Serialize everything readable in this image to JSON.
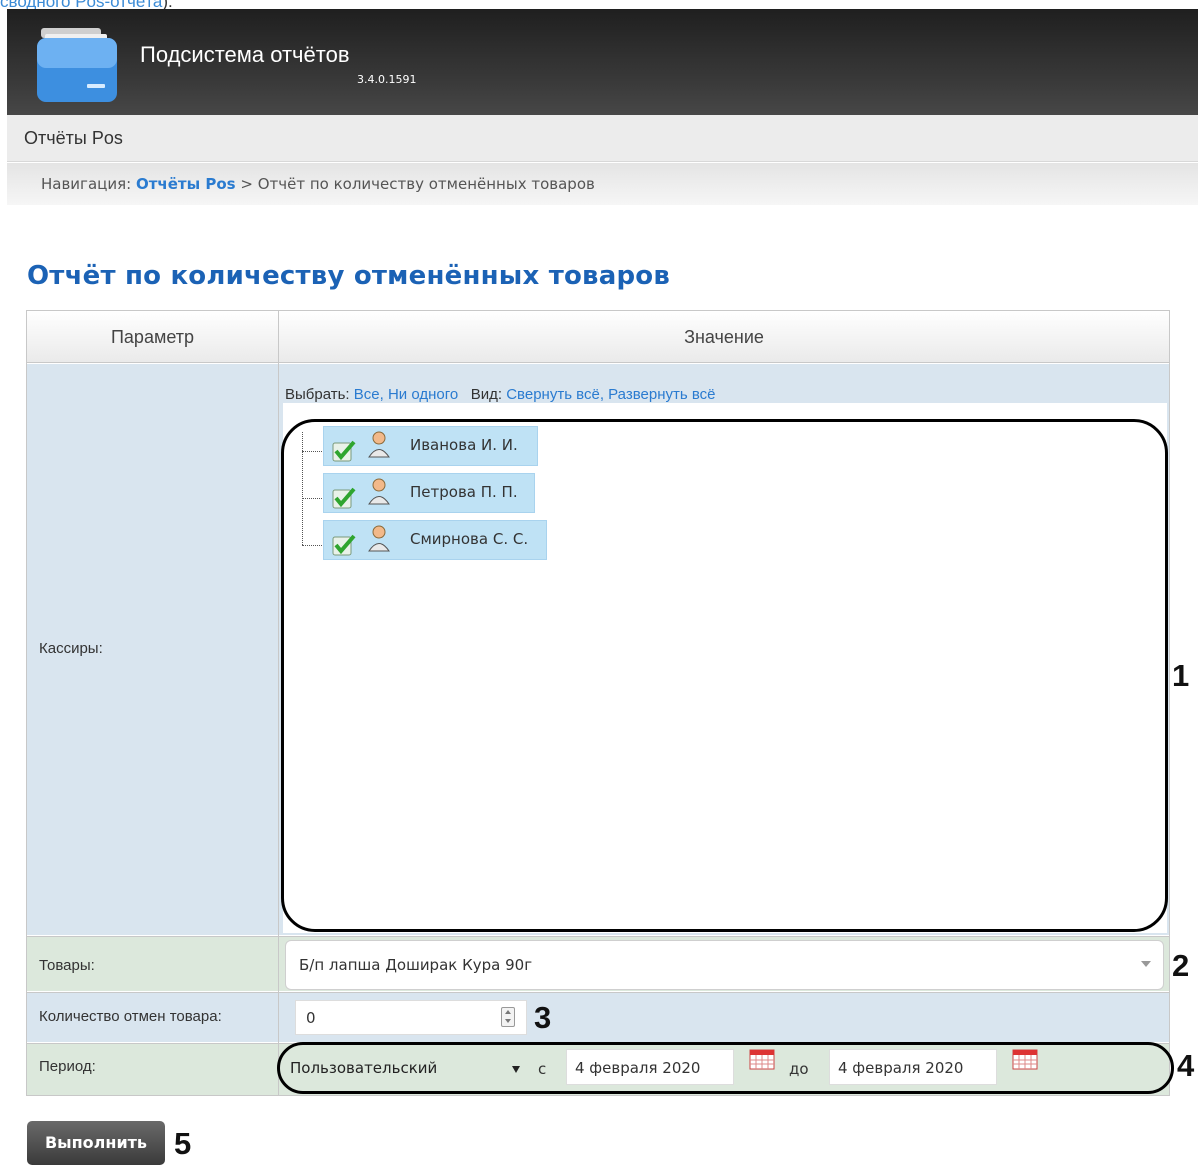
{
  "top_link": {
    "text": "сводного Pos-отчёта",
    "tail": ")."
  },
  "app": {
    "title": "Подсистема отчётов",
    "version": "3.4.0.1591"
  },
  "section": {
    "title": "Отчёты Pos"
  },
  "breadcrumb": {
    "prefix": "Навигация:",
    "link": "Отчёты Pos",
    "separator": ">",
    "current": "Отчёт по количеству отменённых товаров"
  },
  "page": {
    "title": "Отчёт по количеству отменённых товаров"
  },
  "table": {
    "header_param": "Параметр",
    "header_value": "Значение",
    "cashiers_label": "Кассиры:",
    "goods_label": "Товары:",
    "count_label": "Количество отмен товара:",
    "period_label": "Период:"
  },
  "selection": {
    "select_label": "Выбрать:",
    "all": "Все,",
    "none": "Ни одного",
    "view_label": "Вид:",
    "collapse": "Свернуть всё,",
    "expand": "Развернуть всё"
  },
  "cashiers": [
    {
      "name": "Иванова И. И.",
      "checked": true
    },
    {
      "name": "Петрова П. П.",
      "checked": true
    },
    {
      "name": "Смирнова С. С.",
      "checked": true
    }
  ],
  "goods": {
    "value": "Б/п лапша Доширак Кура 90г"
  },
  "count": {
    "value": "0"
  },
  "period": {
    "type": "Пользовательский",
    "from_label": "с",
    "from": "4 февраля 2020",
    "to_label": "до",
    "to": "4 февраля 2020"
  },
  "run_button": {
    "label": "Выполнить"
  },
  "callouts": [
    "1",
    "2",
    "3",
    "4",
    "5"
  ],
  "colors": {
    "accent": "#1b62b5",
    "link": "#2a7bd0",
    "node_bg": "#bfe2f5"
  }
}
